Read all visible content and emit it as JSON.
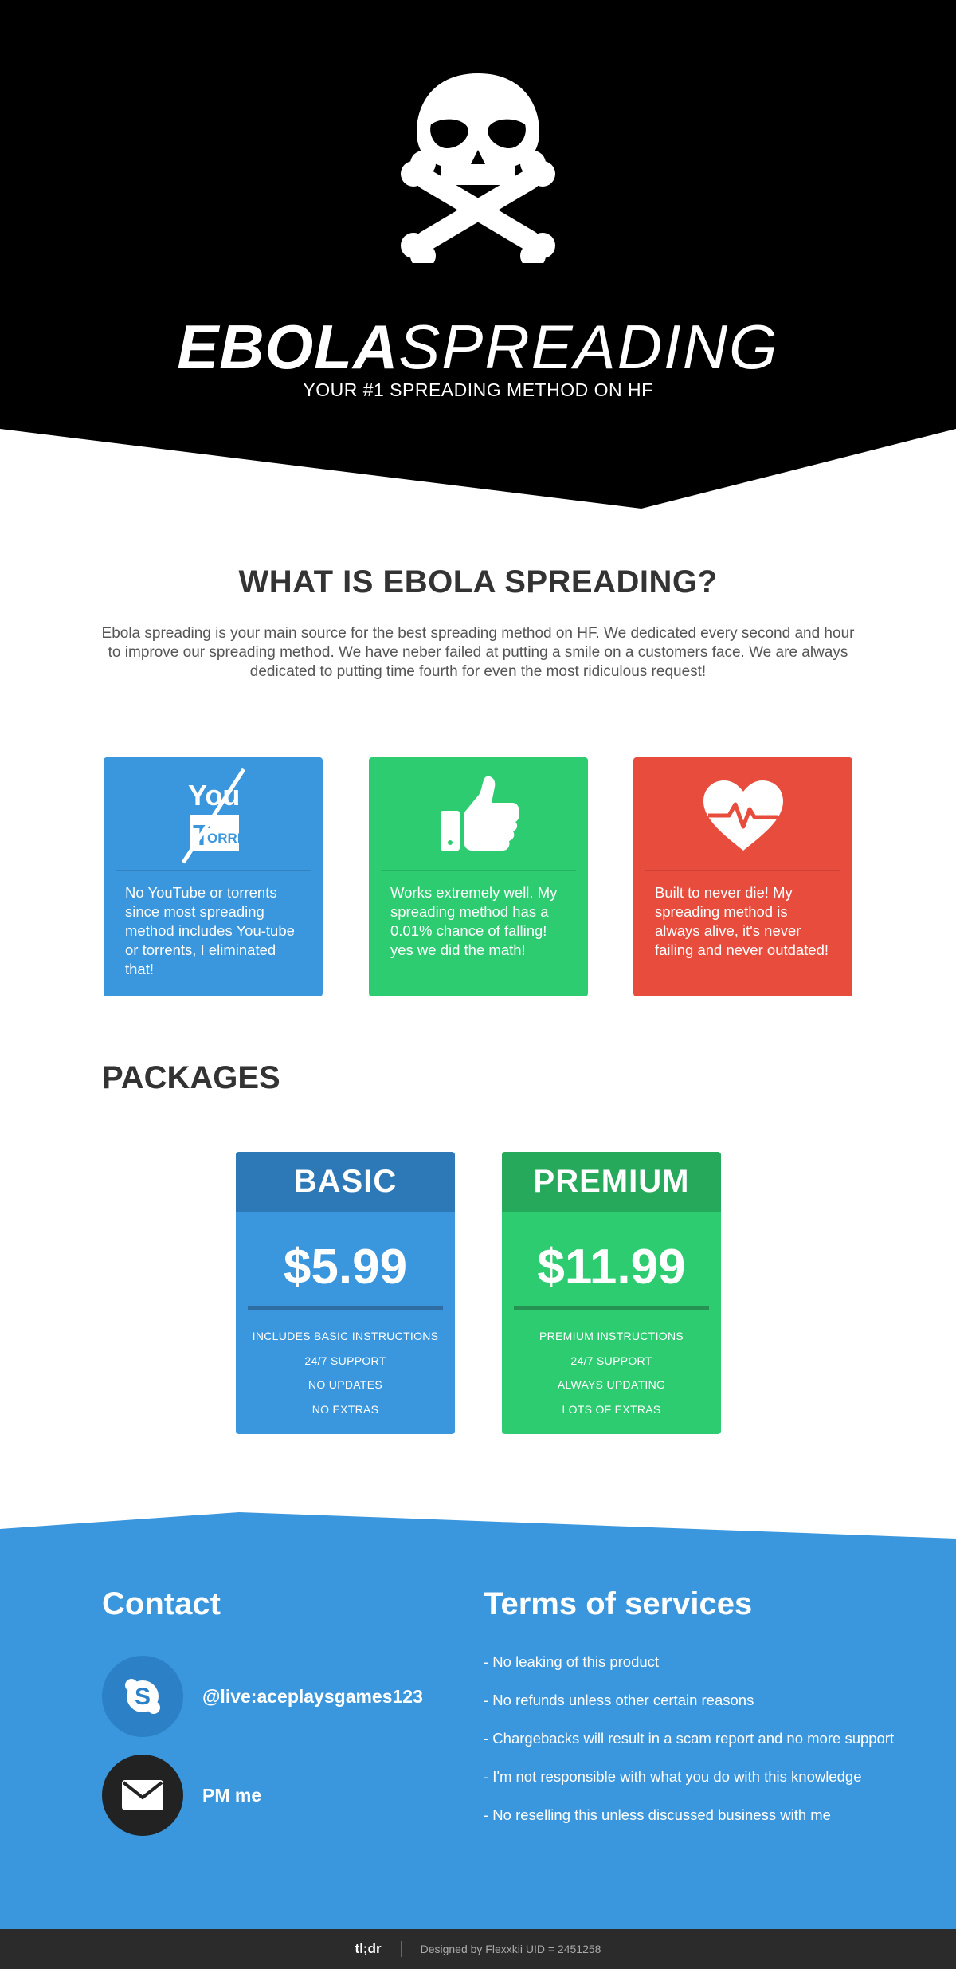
{
  "hero": {
    "brand_bold": "EBOLA",
    "brand_light": "SPREADING",
    "tagline": "YOUR #1 SPREADING METHOD ON HF",
    "icon": "skull-crossbones-icon"
  },
  "about": {
    "title": "WHAT IS EBOLA SPREADING?",
    "text": "Ebola spreading is your main source for the best spreading method on HF. We dedicated every second and hour to improve our spreading method. We have neber failed at putting a smile on a customers face. We are always dedicated to putting time fourth for even the most ridiculous request!"
  },
  "features": [
    {
      "icon": "no-youtube-torrent-icon",
      "icon_text_1": "You",
      "icon_text_2": "T",
      "icon_text_3": "ORRENT",
      "text": "No YouTube or torrents since most spreading method includes You-tube or torrents, I eliminated that!",
      "color": "#3a96dd"
    },
    {
      "icon": "thumbs-up-icon",
      "text": "Works extremely well. My spreading method has a 0.01% chance of falling! yes we did the math!",
      "color": "#2ecc71"
    },
    {
      "icon": "heartbeat-icon",
      "text": "Built to never die! My spreading method is always alive, it's never failing and never outdated!",
      "color": "#e74c3c"
    }
  ],
  "packages": {
    "title": "PACKAGES",
    "items": [
      {
        "name": "BASIC",
        "price": "$5.99",
        "features": [
          "INCLUDES BASIC INSTRUCTIONS",
          "24/7 SUPPORT",
          "NO UPDATES",
          "NO EXTRAS"
        ]
      },
      {
        "name": "PREMIUM",
        "price": "$11.99",
        "features": [
          "PREMIUM INSTRUCTIONS",
          "24/7 SUPPORT",
          "ALWAYS UPDATING",
          "LOTS OF EXTRAS"
        ]
      }
    ]
  },
  "contact": {
    "title": "Contact",
    "skype": {
      "icon": "skype-icon",
      "label": "@live:aceplaysgames123"
    },
    "mail": {
      "icon": "envelope-icon",
      "label": "PM me"
    }
  },
  "tos": {
    "title": "Terms of services",
    "items": [
      "- No leaking of this product",
      "- No refunds unless other certain reasons",
      "- Chargebacks will result in a scam report and no more support",
      "- I'm not responsible with what you do with this knowledge",
      "- No reselling this unless discussed business with me"
    ]
  },
  "footer": {
    "logo": "tl;dr",
    "credit": "Designed by Flexxkii UID = 2451258"
  },
  "colors": {
    "blue": "#3a96dd",
    "green": "#2ecc71",
    "red": "#e74c3c",
    "dark": "#000000"
  }
}
